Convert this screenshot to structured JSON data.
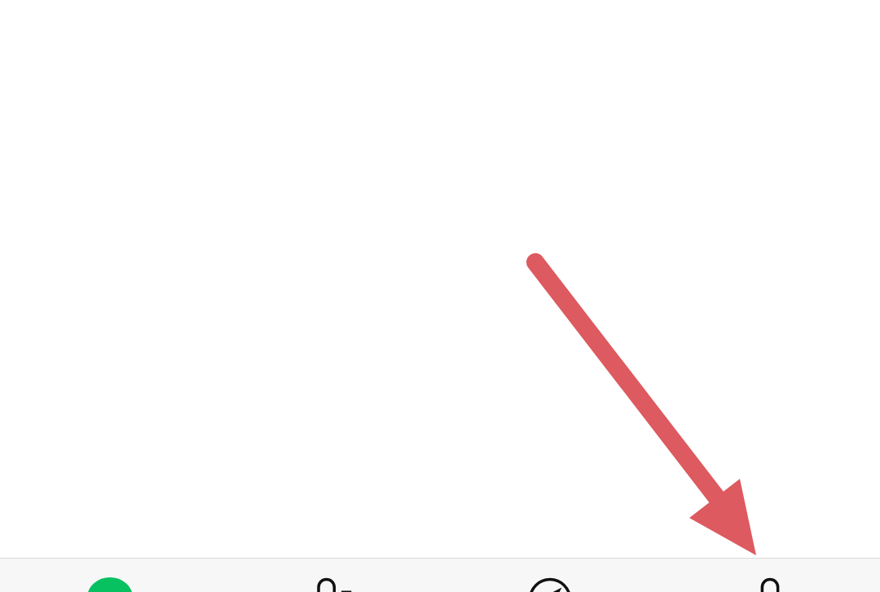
{
  "tab_bar": {
    "tabs": [
      {
        "kind": "chats",
        "selected": true
      },
      {
        "kind": "contacts",
        "selected": false
      },
      {
        "kind": "discover",
        "selected": false
      },
      {
        "kind": "me",
        "selected": false
      }
    ]
  },
  "annotation": {
    "kind": "arrow"
  }
}
